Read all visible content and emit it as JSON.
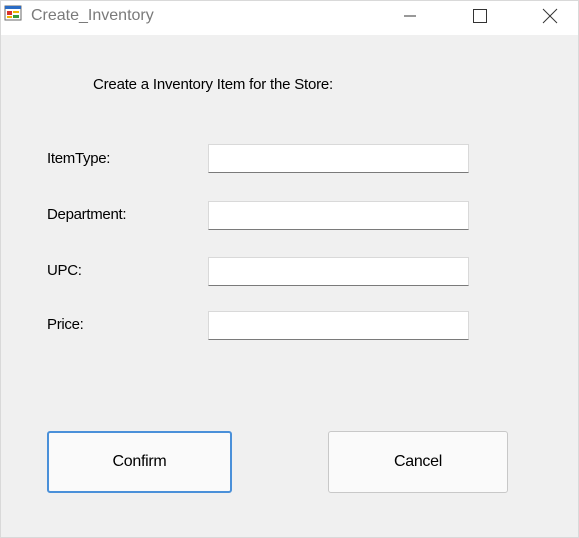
{
  "window": {
    "title": "Create_Inventory"
  },
  "form": {
    "heading": "Create a Inventory Item for the Store:",
    "fields": [
      {
        "label": "ItemType:",
        "value": ""
      },
      {
        "label": "Department:",
        "value": ""
      },
      {
        "label": "UPC:",
        "value": ""
      },
      {
        "label": "Price:",
        "value": ""
      }
    ]
  },
  "buttons": {
    "confirm_label": "Confirm",
    "cancel_label": "Cancel"
  },
  "colors": {
    "focus_border": "#4a90d9",
    "window_bg": "#f0f0f0"
  }
}
